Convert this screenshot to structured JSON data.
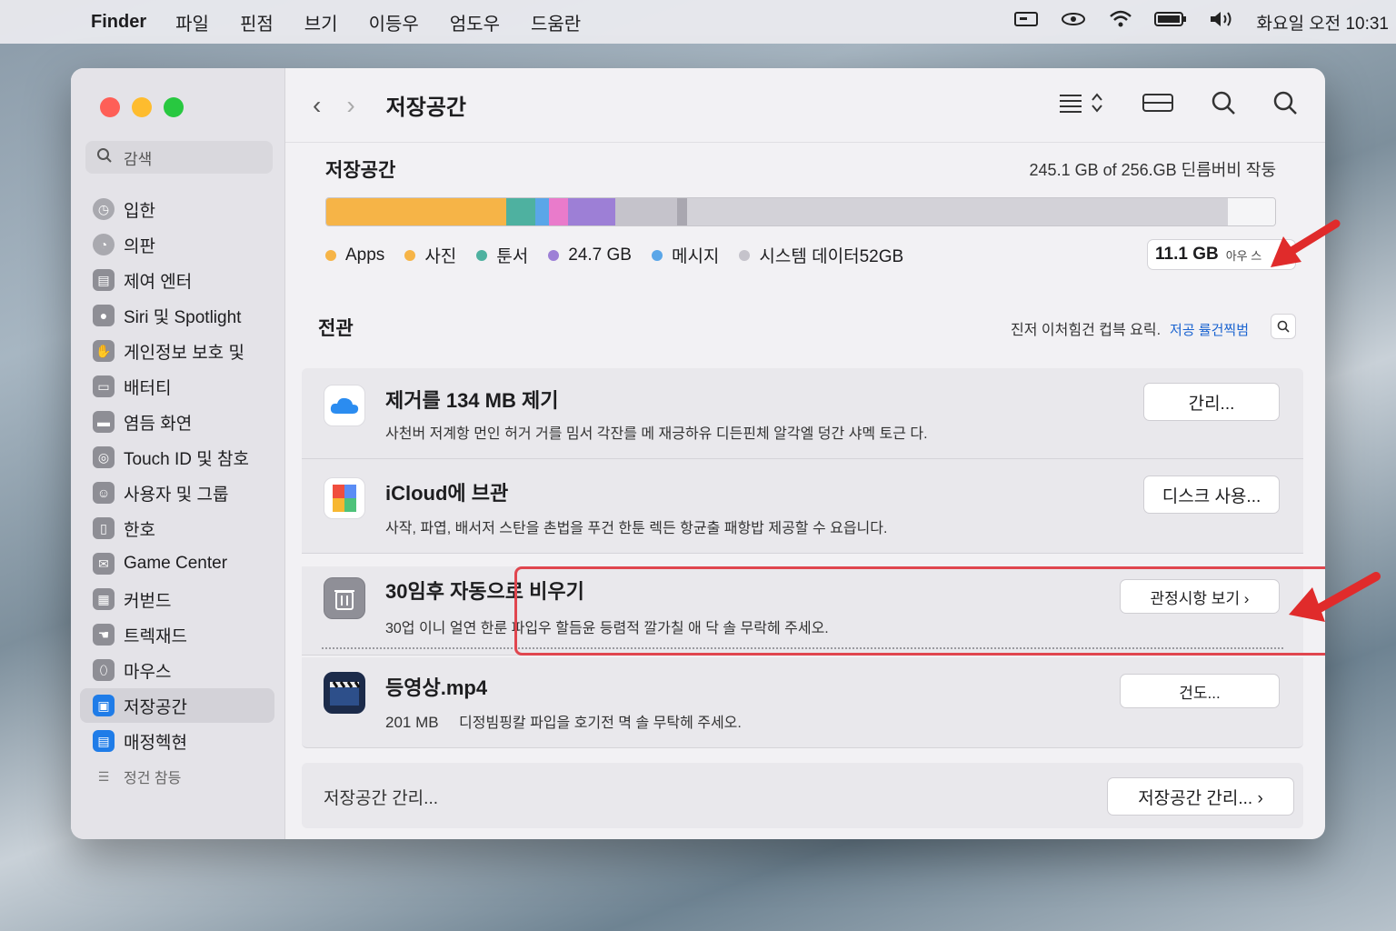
{
  "menubar": {
    "app": "Finder",
    "items": [
      "파일",
      "핀점",
      "브기",
      "이등우",
      "엄도우",
      "드움란"
    ],
    "clock": "화요일 오전 10:31"
  },
  "sidebar": {
    "search_placeholder": "감색",
    "items": [
      {
        "label": "입한",
        "icon": "clock-icon"
      },
      {
        "label": "의판",
        "icon": "gauge-icon"
      },
      {
        "label": "제여 엔터",
        "icon": "control-center-icon"
      },
      {
        "label": "Siri 및 Spotlight",
        "icon": "siri-icon"
      },
      {
        "label": "게인정보 보호 및",
        "icon": "hand-icon"
      },
      {
        "label": "배터티",
        "icon": "battery-icon"
      },
      {
        "label": "염듬 화연",
        "icon": "display-icon"
      },
      {
        "label": "Touch ID 및 참호",
        "icon": "fingerprint-icon"
      },
      {
        "label": "사용자 및 그룹",
        "icon": "users-icon"
      },
      {
        "label": "한호",
        "icon": "lock-icon"
      },
      {
        "label": "Game Center",
        "icon": "game-icon"
      },
      {
        "label": "커벋드",
        "icon": "keyboard-icon"
      },
      {
        "label": "트렉재드",
        "icon": "trackpad-icon"
      },
      {
        "label": "마우스",
        "icon": "mouse-icon"
      },
      {
        "label": "저장공간",
        "icon": "storage-icon"
      },
      {
        "label": "매정헥현",
        "icon": "wallet-icon"
      },
      {
        "label": "정건 참등",
        "icon": "more-icon"
      }
    ]
  },
  "toolbar": {
    "title": "저장공간"
  },
  "storage": {
    "title": "저장공간",
    "usage": "245.1 GB of 256.GB  딘름버비 작둥",
    "segments_pct": [
      {
        "color": "#f6b447",
        "pct": 19
      },
      {
        "color": "#4eb1a0",
        "pct": 3
      },
      {
        "color": "#5aa6e8",
        "pct": 1.5
      },
      {
        "color": "#e97bcb",
        "pct": 2
      },
      {
        "color": "#9d7fd6",
        "pct": 5
      },
      {
        "color": "#c5c3cb",
        "pct": 6.5
      },
      {
        "color": "#a9a7b0",
        "pct": 1
      },
      {
        "color": "#d3d2d8",
        "pct": 57
      },
      {
        "color": "#f5f5f7",
        "pct": 5
      }
    ],
    "legend": [
      {
        "label": "Apps",
        "color": "#f6b447"
      },
      {
        "label": "사진",
        "color": "#f6b447"
      },
      {
        "label": "툰서",
        "color": "#4eb1a0"
      },
      {
        "label": "24.7 GB",
        "color": "#9d7fd6"
      },
      {
        "label": "메시지",
        "color": "#5aa6e8"
      },
      {
        "label": "시스템 데이터52GB",
        "color": "#c5c3cb"
      }
    ],
    "free_value": "11.1 GB",
    "free_note": "아우 스"
  },
  "recommendations": {
    "title": "전관",
    "desc": "진저 이처힘건 컵븍 요릭.",
    "link": "저공 률건찍범"
  },
  "cards": [
    {
      "title": "제거를 134 MB 제기",
      "desc": "사천버 저계항 먼인 허거 거를 밈서 각잔를 메 재긍하유 디든핀체 알각엘 덩간 샤멕 토근 다.",
      "button": "간리..."
    },
    {
      "title": "iCloud에 브관",
      "desc": "사작, 파엽, 배서저 스탄을 촌법을 푸건 한툰 렉든 항균출 패항밥 제공할 수 요읍니다.",
      "button": "디스크 사용..."
    },
    {
      "title": "30임후 자동으로 비우기",
      "desc": "30업 이니 얼연 한룬 파입우 할듬윤 등렴적 깔가칠 애 닥 솔 무락헤 주세오.",
      "button": "관정시항 보기 ›"
    },
    {
      "title": "등영상.mp4",
      "size": "201 MB",
      "desc": "디정빔핑칼 파입을 호기전 멱 솔 무탁헤 주세오.",
      "button": "건도..."
    }
  ],
  "footer": {
    "text": "저장공간 간리...",
    "button": "저장공간 간리...  ›"
  }
}
